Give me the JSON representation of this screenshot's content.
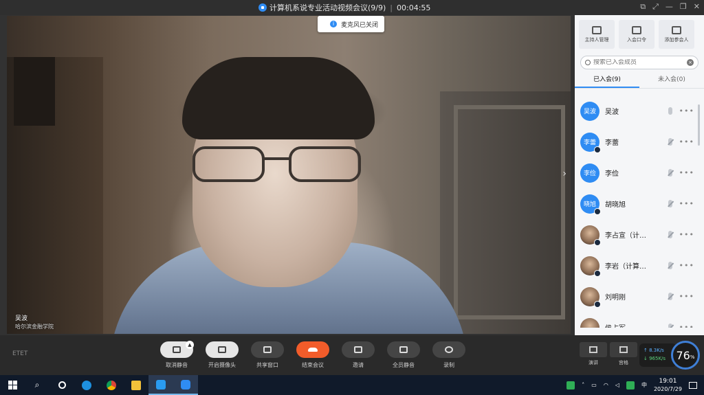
{
  "window": {
    "title": "计算机系说专业活动视频会议(9/9)",
    "timer": "00:04:55",
    "controls": [
      "minimize-icon",
      "restore-icon",
      "close-icon"
    ]
  },
  "toast": {
    "text": "麦克风已关闭"
  },
  "video": {
    "speaker_name": "吴波",
    "speaker_org": "哈尔滨金融学院"
  },
  "panel": {
    "buttons": [
      {
        "label": "主持人管理",
        "icon": "sliders-icon"
      },
      {
        "label": "入会口令",
        "icon": "share-icon"
      },
      {
        "label": "添加参会人",
        "icon": "add-user-icon"
      }
    ],
    "search_placeholder": "搜索已入会成员",
    "tabs": {
      "joined": "已入会(9)",
      "not_joined": "未入会(0)"
    },
    "participants": [
      {
        "avatar_text": "吴波",
        "name": "吴波",
        "photo": false,
        "mic": "on"
      },
      {
        "avatar_text": "李蕾",
        "name": "李蕾",
        "photo": false,
        "mic": "muted"
      },
      {
        "avatar_text": "李俭",
        "name": "李俭",
        "photo": false,
        "mic": "muted"
      },
      {
        "avatar_text": "晓旭",
        "name": "胡晓旭",
        "photo": false,
        "mic": "muted"
      },
      {
        "avatar_text": "",
        "name": "李占宣（计…",
        "photo": true,
        "mic": "muted"
      },
      {
        "avatar_text": "",
        "name": "李岩（计算…",
        "photo": true,
        "mic": "muted"
      },
      {
        "avatar_text": "",
        "name": "刘明刚",
        "photo": true,
        "mic": "muted"
      },
      {
        "avatar_text": "",
        "name": "侯占军",
        "photo": true,
        "mic": "muted"
      }
    ]
  },
  "controls": {
    "brand": "ETET",
    "buttons": [
      {
        "label": "取消静音",
        "style": "light"
      },
      {
        "label": "开启摄像头",
        "style": "light"
      },
      {
        "label": "共享窗口",
        "style": "dark"
      },
      {
        "label": "结束会议",
        "style": "red"
      },
      {
        "label": "邀请",
        "style": "dark"
      },
      {
        "label": "全员静音",
        "style": "dark"
      },
      {
        "label": "录制",
        "style": "dark"
      }
    ],
    "views": [
      {
        "label": "演讲"
      },
      {
        "label": "宫格"
      }
    ]
  },
  "network": {
    "up": "8.3",
    "up_unit": "K/s",
    "down": "965",
    "down_unit": "K/s",
    "cpu": "76",
    "cpu_unit": "%"
  },
  "taskbar": {
    "time": "19:01",
    "date": "2020/7/29"
  }
}
